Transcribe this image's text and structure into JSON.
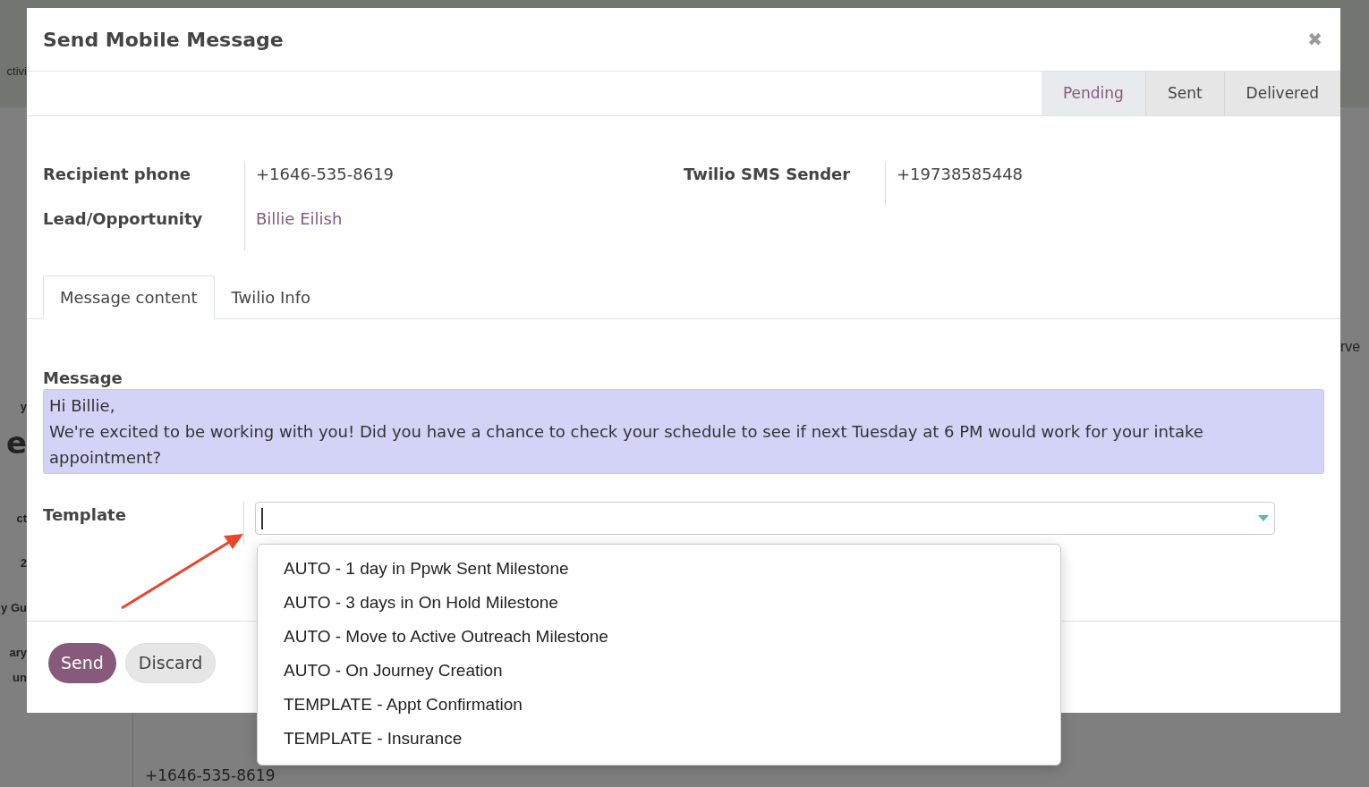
{
  "background": {
    "left_fragments": [
      {
        "text": "ctivi",
        "kind": "plain"
      },
      {
        "text": "y",
        "kind": "bold"
      },
      {
        "text": "e",
        "kind": "large"
      },
      {
        "text": "ct",
        "kind": "bold"
      },
      {
        "text": "2",
        "kind": "bold"
      },
      {
        "text": "y Gu",
        "kind": "bold"
      },
      {
        "text": "ary",
        "kind": "bold"
      },
      {
        "text": "un",
        "kind": "bold"
      }
    ],
    "right_fragments": [
      {
        "text": "rve"
      }
    ],
    "bottom_text": "+1646-535-8619"
  },
  "dialog": {
    "title": "Send Mobile Message",
    "close": "✖",
    "stages": [
      {
        "label": "Pending",
        "selected": true
      },
      {
        "label": "Sent",
        "selected": false
      },
      {
        "label": "Delivered",
        "selected": false
      }
    ],
    "fields_left": [
      {
        "label": "Recipient phone",
        "value": "+1646-535-8619",
        "kind": "text"
      },
      {
        "label": "Lead/Opportunity",
        "value": "Billie Eilish",
        "kind": "link"
      }
    ],
    "fields_right": [
      {
        "label": "Twilio SMS Sender",
        "value": "+19738585448"
      }
    ],
    "tabs": [
      {
        "label": "Message content",
        "selected": true
      },
      {
        "label": "Twilio Info",
        "selected": false
      }
    ],
    "message": {
      "label": "Message",
      "lines": [
        "Hi Billie,",
        "We're excited to be working with you! Did you have a chance to check your schedule to see if next Tuesday at 6 PM would work for your intake appointment?"
      ]
    },
    "template": {
      "label": "Template",
      "options": [
        "AUTO - 1 day in Ppwk Sent Milestone",
        "AUTO - 3 days in On Hold Milestone",
        "AUTO - Move to Active Outreach Milestone",
        "AUTO - On Journey Creation",
        "TEMPLATE - Appt Confirmation",
        "TEMPLATE - Insurance"
      ]
    },
    "buttons": [
      {
        "label": "Send",
        "kind": "primary"
      },
      {
        "label": "Discard",
        "kind": "secondary"
      }
    ]
  }
}
